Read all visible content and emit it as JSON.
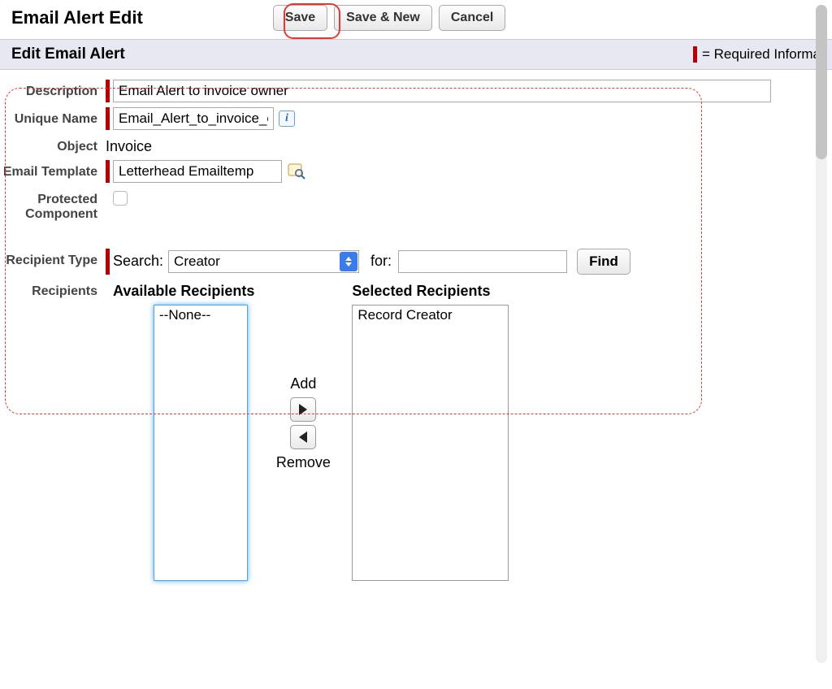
{
  "header": {
    "title": "Email Alert Edit",
    "buttons": {
      "save": "Save",
      "save_new": "Save & New",
      "cancel": "Cancel"
    }
  },
  "section": {
    "title": "Edit Email Alert",
    "required_hint": "= Required Informa"
  },
  "form": {
    "description": {
      "label": "Description",
      "value": "Email Alert to invoice owner"
    },
    "unique_name": {
      "label": "Unique Name",
      "value": "Email_Alert_to_invoice_o"
    },
    "object": {
      "label": "Object",
      "value": "Invoice"
    },
    "email_template": {
      "label": "Email Template",
      "value": "Letterhead Emailtemp"
    },
    "protected": {
      "label": "Protected Component",
      "checked": false
    },
    "recipient_type": {
      "label": "Recipient Type",
      "search_label": "Search:",
      "search_value": "Creator",
      "for_label": "for:",
      "for_value": "",
      "find": "Find"
    },
    "recipients": {
      "label": "Recipients",
      "available_title": "Available Recipients",
      "selected_title": "Selected Recipients",
      "available_options": [
        "--None--"
      ],
      "selected_options": [
        "Record Creator"
      ],
      "add_label": "Add",
      "remove_label": "Remove"
    }
  }
}
